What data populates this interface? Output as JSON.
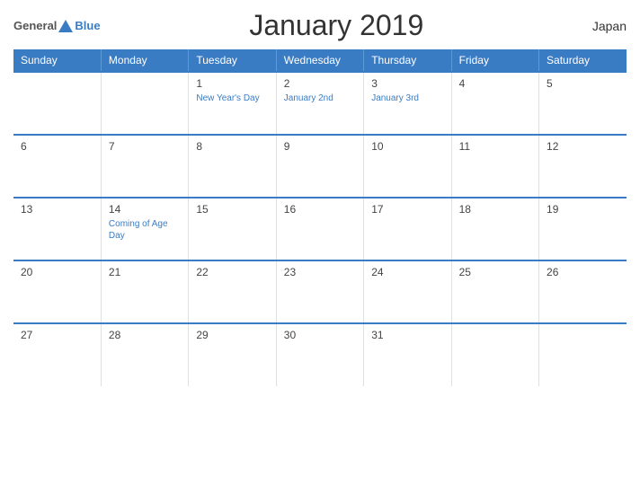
{
  "header": {
    "logo": {
      "general": "General",
      "blue": "Blue"
    },
    "title": "January 2019",
    "country": "Japan"
  },
  "calendar": {
    "weekdays": [
      "Sunday",
      "Monday",
      "Tuesday",
      "Wednesday",
      "Thursday",
      "Friday",
      "Saturday"
    ],
    "weeks": [
      [
        {
          "day": "",
          "holiday": ""
        },
        {
          "day": "",
          "holiday": ""
        },
        {
          "day": "1",
          "holiday": "New Year's Day"
        },
        {
          "day": "2",
          "holiday": "January 2nd"
        },
        {
          "day": "3",
          "holiday": "January 3rd"
        },
        {
          "day": "4",
          "holiday": ""
        },
        {
          "day": "5",
          "holiday": ""
        }
      ],
      [
        {
          "day": "6",
          "holiday": ""
        },
        {
          "day": "7",
          "holiday": ""
        },
        {
          "day": "8",
          "holiday": ""
        },
        {
          "day": "9",
          "holiday": ""
        },
        {
          "day": "10",
          "holiday": ""
        },
        {
          "day": "11",
          "holiday": ""
        },
        {
          "day": "12",
          "holiday": ""
        }
      ],
      [
        {
          "day": "13",
          "holiday": ""
        },
        {
          "day": "14",
          "holiday": "Coming of Age Day"
        },
        {
          "day": "15",
          "holiday": ""
        },
        {
          "day": "16",
          "holiday": ""
        },
        {
          "day": "17",
          "holiday": ""
        },
        {
          "day": "18",
          "holiday": ""
        },
        {
          "day": "19",
          "holiday": ""
        }
      ],
      [
        {
          "day": "20",
          "holiday": ""
        },
        {
          "day": "21",
          "holiday": ""
        },
        {
          "day": "22",
          "holiday": ""
        },
        {
          "day": "23",
          "holiday": ""
        },
        {
          "day": "24",
          "holiday": ""
        },
        {
          "day": "25",
          "holiday": ""
        },
        {
          "day": "26",
          "holiday": ""
        }
      ],
      [
        {
          "day": "27",
          "holiday": ""
        },
        {
          "day": "28",
          "holiday": ""
        },
        {
          "day": "29",
          "holiday": ""
        },
        {
          "day": "30",
          "holiday": ""
        },
        {
          "day": "31",
          "holiday": ""
        },
        {
          "day": "",
          "holiday": ""
        },
        {
          "day": "",
          "holiday": ""
        }
      ]
    ]
  }
}
